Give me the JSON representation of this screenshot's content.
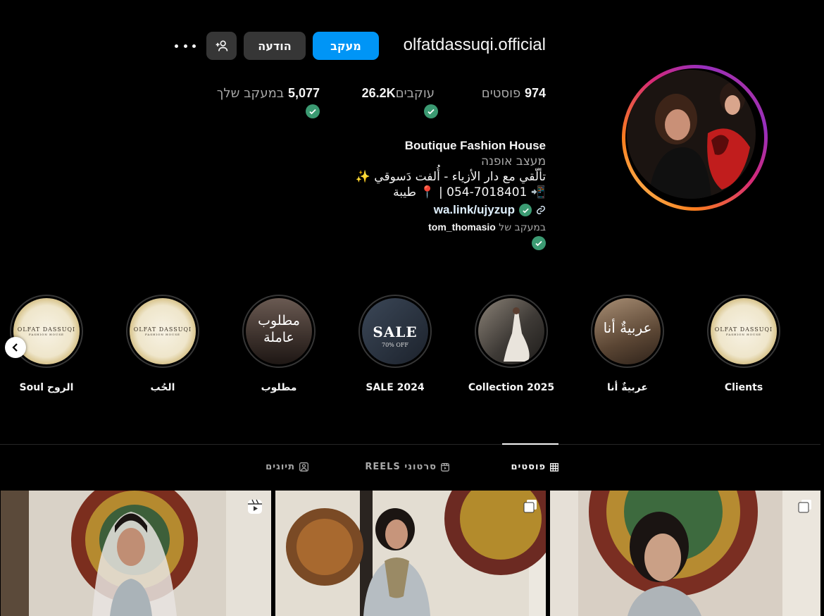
{
  "profile": {
    "username": "olfatdassuqi.official",
    "follow_label": "מעקב",
    "message_label": "הודעה",
    "stats": {
      "posts_count": "974",
      "posts_label": "פוסטים",
      "followers_count": "26.2K",
      "followers_label": "עוקבים",
      "following_count": "5,077",
      "following_label": "במעקב שלך"
    },
    "full_name": "Boutique Fashion House",
    "category": "מעצב אופנה",
    "bio_line1": "تألّقي مع دار الأزياء - أُلفت دَسوقي ✨",
    "bio_line2": "📲 054-7018401 | 📍 طيبة",
    "link": "wa.link/ujyzup",
    "followed_by_prefix": "במעקב של",
    "followed_by_user": "tom_thomasio"
  },
  "highlights": [
    {
      "label": "Clients",
      "kind": "logo"
    },
    {
      "label": "عربيةٌ أنا",
      "kind": "photo",
      "overlay": "عربيةٌ أنا"
    },
    {
      "label": "Collection 2025",
      "kind": "photo"
    },
    {
      "label": "2024 SALE",
      "kind": "sale",
      "overlay": "SALE",
      "overlay_sub": "70% OFF"
    },
    {
      "label": "مطلوب",
      "kind": "text",
      "overlay": "مطلوب عاملة"
    },
    {
      "label": "الحُب",
      "kind": "logo"
    },
    {
      "label": "الروح Soul",
      "kind": "logo"
    }
  ],
  "logo_text": "OLFAT DASSUQI",
  "logo_sub": "FASHION HOUSE",
  "tabs": [
    {
      "label": "פוסטים",
      "active": true
    },
    {
      "label": "סרטוני REELS",
      "active": false
    },
    {
      "label": "תיוגים",
      "active": false
    }
  ],
  "colors": {
    "background": "#000000",
    "primary_button": "#0095f6",
    "secondary_button": "#363636",
    "verified_check": "#3b9a72",
    "muted_text": "#a8a8a8"
  }
}
